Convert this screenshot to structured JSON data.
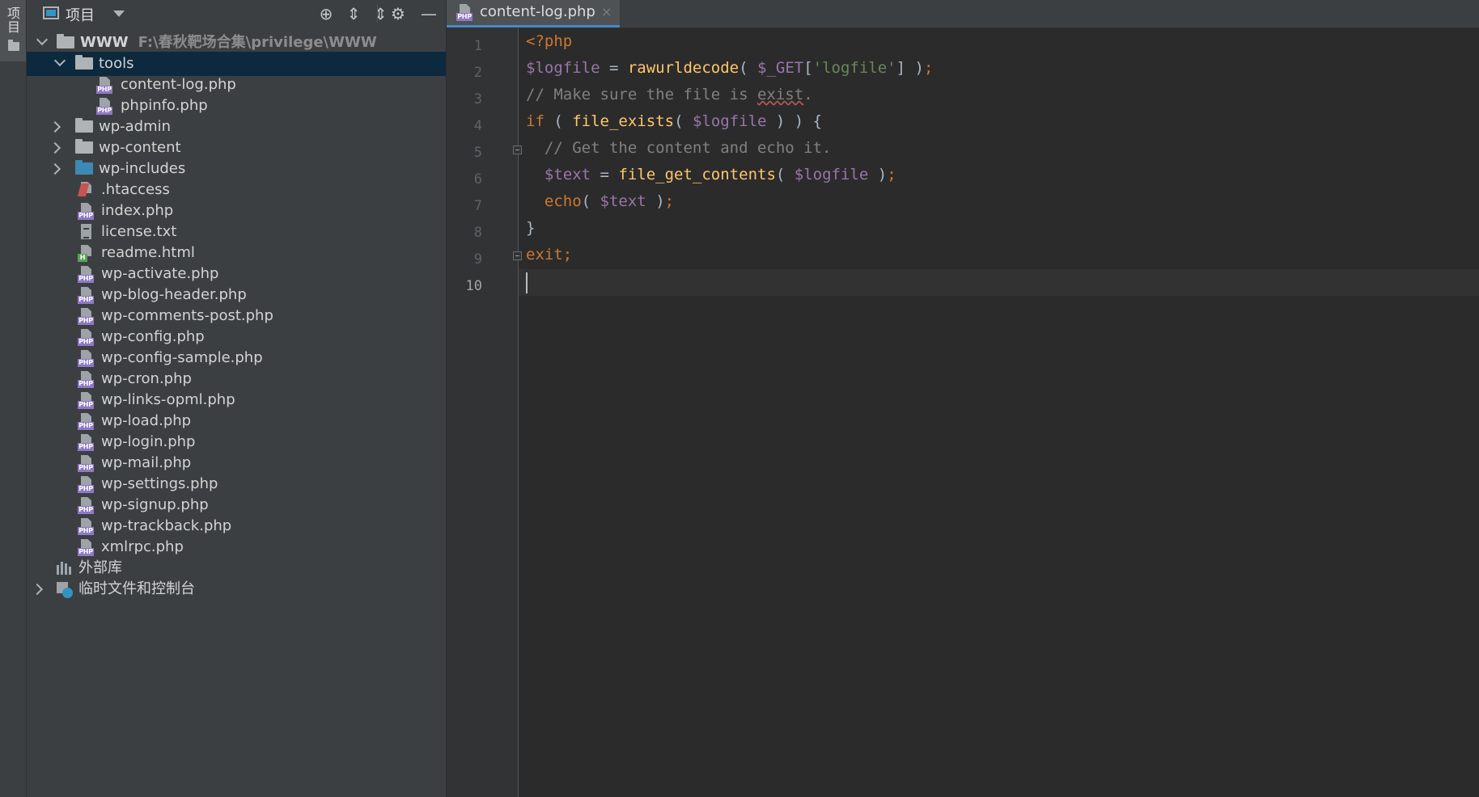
{
  "sidebar_strip": {
    "label": "项目"
  },
  "project_panel": {
    "title": "项目",
    "toolbar": [
      {
        "name": "locate-icon",
        "glyph": "⊕"
      },
      {
        "name": "expand-all-icon",
        "glyph": "⇕"
      },
      {
        "name": "collapse-all-icon",
        "glyph": "⇔"
      },
      {
        "name": "gear-icon",
        "glyph": "⚙"
      },
      {
        "name": "minimize-icon",
        "glyph": "—"
      }
    ],
    "root": {
      "label": "WWW",
      "path": "F:\\春秋靶场合集\\privilege\\WWW"
    },
    "items": [
      {
        "label": "tools",
        "type": "folder"
      },
      {
        "label": "content-log.php",
        "type": "php"
      },
      {
        "label": "phpinfo.php",
        "type": "php"
      },
      {
        "label": "wp-admin",
        "type": "folder"
      },
      {
        "label": "wp-content",
        "type": "folder"
      },
      {
        "label": "wp-includes",
        "type": "folder"
      },
      {
        "label": ".htaccess",
        "type": "htaccess"
      },
      {
        "label": "index.php",
        "type": "php"
      },
      {
        "label": "license.txt",
        "type": "txt"
      },
      {
        "label": "readme.html",
        "type": "html"
      },
      {
        "label": "wp-activate.php",
        "type": "php"
      },
      {
        "label": "wp-blog-header.php",
        "type": "php"
      },
      {
        "label": "wp-comments-post.php",
        "type": "php"
      },
      {
        "label": "wp-config.php",
        "type": "php"
      },
      {
        "label": "wp-config-sample.php",
        "type": "php"
      },
      {
        "label": "wp-cron.php",
        "type": "php"
      },
      {
        "label": "wp-links-opml.php",
        "type": "php"
      },
      {
        "label": "wp-load.php",
        "type": "php"
      },
      {
        "label": "wp-login.php",
        "type": "php"
      },
      {
        "label": "wp-mail.php",
        "type": "php"
      },
      {
        "label": "wp-settings.php",
        "type": "php"
      },
      {
        "label": "wp-signup.php",
        "type": "php"
      },
      {
        "label": "wp-trackback.php",
        "type": "php"
      },
      {
        "label": "xmlrpc.php",
        "type": "php"
      }
    ],
    "external_libraries": "外部库",
    "scratches": "临时文件和控制台",
    "file_badges": {
      "php": "PHP",
      "html": "H"
    }
  },
  "editor": {
    "tab": {
      "label": "content-log.php",
      "close": "×"
    },
    "line_numbers": [
      "1",
      "2",
      "3",
      "4",
      "5",
      "6",
      "7",
      "8",
      "9",
      "10"
    ],
    "active_line": "10",
    "colors": {
      "keyword": "#cc7832",
      "variable": "#9876aa",
      "function": "#ffc66d",
      "string": "#6a8759",
      "comment": "#808080",
      "text": "#a9b7c6",
      "accent": "#4a88c7"
    },
    "lines": [
      [
        {
          "t": "<?php",
          "c": "keyword"
        }
      ],
      [
        {
          "t": "$logfile",
          "c": "variable"
        },
        {
          "t": " = ",
          "c": "text"
        },
        {
          "t": "rawurldecode",
          "c": "function"
        },
        {
          "t": "( ",
          "c": "text"
        },
        {
          "t": "$_GET",
          "c": "variable"
        },
        {
          "t": "[",
          "c": "text"
        },
        {
          "t": "'logfile'",
          "c": "string"
        },
        {
          "t": "] )",
          "c": "text"
        },
        {
          "t": ";",
          "c": "keyword"
        }
      ],
      [
        {
          "t": "// Make sure the file is exist.",
          "c": "comment"
        }
      ],
      [
        {
          "t": "if",
          "c": "keyword"
        },
        {
          "t": " ( ",
          "c": "text"
        },
        {
          "t": "file_exists",
          "c": "function"
        },
        {
          "t": "( ",
          "c": "text"
        },
        {
          "t": "$logfile",
          "c": "variable"
        },
        {
          "t": " ) ) {",
          "c": "text"
        }
      ],
      [
        {
          "t": "  // Get the content and echo it.",
          "c": "comment"
        }
      ],
      [
        {
          "t": "  ",
          "c": "text"
        },
        {
          "t": "$text",
          "c": "variable"
        },
        {
          "t": " = ",
          "c": "text"
        },
        {
          "t": "file_get_contents",
          "c": "function"
        },
        {
          "t": "( ",
          "c": "text"
        },
        {
          "t": "$logfile",
          "c": "variable"
        },
        {
          "t": " )",
          "c": "text"
        },
        {
          "t": ";",
          "c": "keyword"
        }
      ],
      [
        {
          "t": "  ",
          "c": "text"
        },
        {
          "t": "echo",
          "c": "keyword"
        },
        {
          "t": "( ",
          "c": "text"
        },
        {
          "t": "$text",
          "c": "variable"
        },
        {
          "t": " )",
          "c": "text"
        },
        {
          "t": ";",
          "c": "keyword"
        }
      ],
      [
        {
          "t": "}",
          "c": "text"
        }
      ],
      [
        {
          "t": "exit",
          "c": "keyword"
        },
        {
          "t": ";",
          "c": "keyword"
        }
      ],
      []
    ]
  }
}
